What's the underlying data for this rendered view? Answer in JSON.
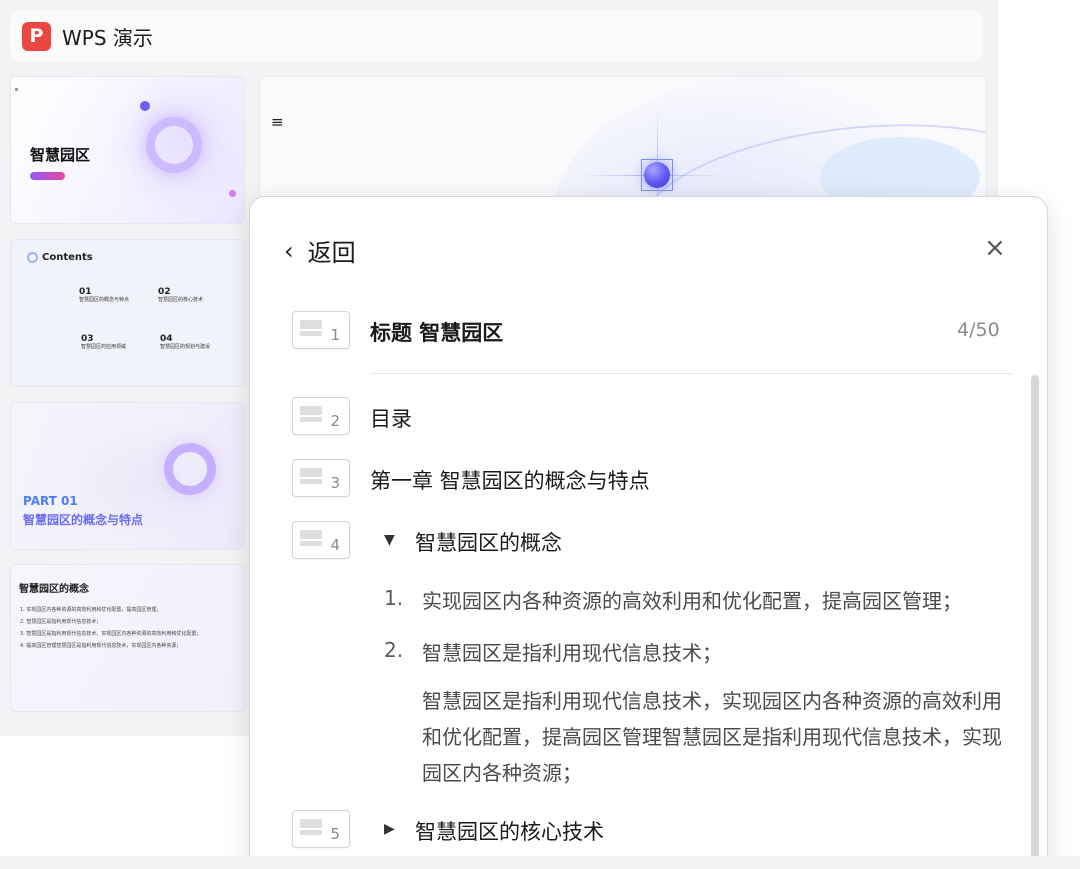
{
  "app": {
    "logo_letter": "P",
    "title": "WPS 演示",
    "accent": "#e9473f"
  },
  "thumbnails": {
    "t1": {
      "title": "智慧园区"
    },
    "t2": {
      "heading": "Contents",
      "items": [
        {
          "num": "01",
          "text": "智慧园区的概念与特点"
        },
        {
          "num": "02",
          "text": "智慧园区的核心技术"
        },
        {
          "num": "03",
          "text": "智慧园区的应用领域"
        },
        {
          "num": "04",
          "text": "智慧园区的规划与建设"
        }
      ]
    },
    "t3": {
      "part": "PART 01",
      "subtitle": "智慧园区的概念与特点"
    },
    "t4": {
      "title": "智慧园区的概念",
      "lines": [
        "1. 实现园区内各种资源的高效利用和优化配置，提高园区管理；",
        "2. 智慧园区是指利用现代信息技术；",
        "3. 智慧园区是指利用现代信息技术，实现园区内各种资源的高效利用和优化配置；",
        "4. 提高园区管理智慧园区是指利用现代信息技术，实现园区内各种资源；"
      ]
    }
  },
  "main_slide": {
    "menu_icon": "≡"
  },
  "panel": {
    "back_label": "返回",
    "back_icon": "‹",
    "close_icon": "×",
    "counter": "4/50",
    "rows": [
      {
        "num": "1",
        "text": "标题  智慧园区"
      },
      {
        "num": "2",
        "text": "目录"
      },
      {
        "num": "3",
        "text": "第一章  智慧园区的概念与特点"
      },
      {
        "num": "4",
        "text": "智慧园区的概念",
        "toggle": "▼"
      },
      {
        "num": "5",
        "text": "智慧园区的核心技术",
        "toggle": "▶"
      }
    ],
    "list": [
      {
        "n": "1.",
        "text": "实现园区内各种资源的高效利用和优化配置，提高园区管理；"
      },
      {
        "n": "2.",
        "text": "智慧园区是指利用现代信息技术；"
      }
    ],
    "paragraph": "智慧园区是指利用现代信息技术，实现园区内各种资源的高效利用和优化配置，提高园区管理智慧园区是指利用现代信息技术，实现园区内各种资源；"
  }
}
